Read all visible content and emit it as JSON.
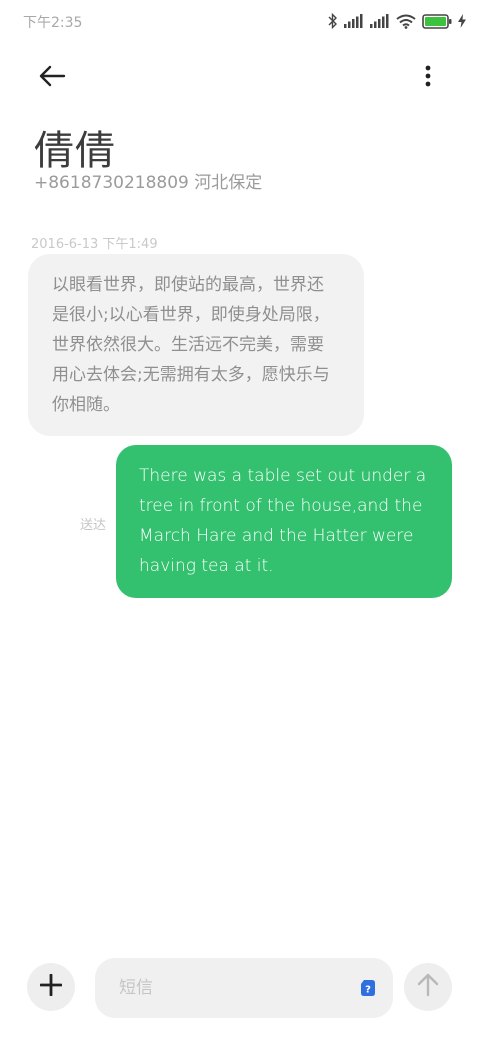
{
  "status_bar": {
    "time": "下午2:35",
    "icons": [
      "bluetooth-icon",
      "signal-icon",
      "signal-icon",
      "wifi-icon",
      "battery-icon",
      "charging-icon"
    ],
    "battery_color": "#3cc23c"
  },
  "header": {
    "back_icon": "arrow-left-icon",
    "more_icon": "more-vertical-icon"
  },
  "contact": {
    "name": "倩倩",
    "number_location": "+8618730218809 河北保定"
  },
  "conversation": {
    "timestamp": "2016-6-13 下午1:49",
    "incoming": {
      "text": "以眼看世界，即使站的最高，世界还是很小;以心看世界，即使身处局限，世界依然很大。生活远不完美，需要用心去体会;无需拥有太多，愿快乐与你相随。",
      "bubble_color": "#f2f2f2"
    },
    "outgoing": {
      "text": "There was a table set out under a tree in front of the house,and the March Hare and the Hatter were having tea at it.",
      "status": "送达",
      "bubble_color": "#33c170"
    }
  },
  "composer": {
    "add_icon": "plus-icon",
    "input_value": "",
    "placeholder": "短信",
    "sim_icon": "sim-card-icon",
    "sim_color": "#2f6fe0",
    "send_icon": "arrow-up-icon"
  }
}
